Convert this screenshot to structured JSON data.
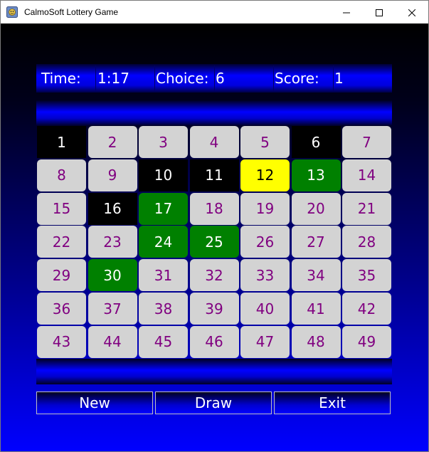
{
  "window": {
    "title": "CalmoSoft Lottery Game"
  },
  "info": {
    "time_label": "Time:",
    "time_value": "1:17",
    "choice_label": "Choice:",
    "choice_value": "6",
    "score_label": "Score:",
    "score_value": "1"
  },
  "grid": {
    "columns": 7,
    "cells": [
      {
        "n": "1",
        "state": "black"
      },
      {
        "n": "2",
        "state": "normal"
      },
      {
        "n": "3",
        "state": "normal"
      },
      {
        "n": "4",
        "state": "normal"
      },
      {
        "n": "5",
        "state": "normal"
      },
      {
        "n": "6",
        "state": "black"
      },
      {
        "n": "7",
        "state": "normal"
      },
      {
        "n": "8",
        "state": "normal"
      },
      {
        "n": "9",
        "state": "normal"
      },
      {
        "n": "10",
        "state": "black"
      },
      {
        "n": "11",
        "state": "black"
      },
      {
        "n": "12",
        "state": "yellow"
      },
      {
        "n": "13",
        "state": "green"
      },
      {
        "n": "14",
        "state": "normal"
      },
      {
        "n": "15",
        "state": "normal"
      },
      {
        "n": "16",
        "state": "black"
      },
      {
        "n": "17",
        "state": "green"
      },
      {
        "n": "18",
        "state": "normal"
      },
      {
        "n": "19",
        "state": "normal"
      },
      {
        "n": "20",
        "state": "normal"
      },
      {
        "n": "21",
        "state": "normal"
      },
      {
        "n": "22",
        "state": "normal"
      },
      {
        "n": "23",
        "state": "normal"
      },
      {
        "n": "24",
        "state": "green"
      },
      {
        "n": "25",
        "state": "green"
      },
      {
        "n": "26",
        "state": "normal"
      },
      {
        "n": "27",
        "state": "normal"
      },
      {
        "n": "28",
        "state": "normal"
      },
      {
        "n": "29",
        "state": "normal"
      },
      {
        "n": "30",
        "state": "green"
      },
      {
        "n": "31",
        "state": "normal"
      },
      {
        "n": "32",
        "state": "normal"
      },
      {
        "n": "33",
        "state": "normal"
      },
      {
        "n": "34",
        "state": "normal"
      },
      {
        "n": "35",
        "state": "normal"
      },
      {
        "n": "36",
        "state": "normal"
      },
      {
        "n": "37",
        "state": "normal"
      },
      {
        "n": "38",
        "state": "normal"
      },
      {
        "n": "39",
        "state": "normal"
      },
      {
        "n": "40",
        "state": "normal"
      },
      {
        "n": "41",
        "state": "normal"
      },
      {
        "n": "42",
        "state": "normal"
      },
      {
        "n": "43",
        "state": "normal"
      },
      {
        "n": "44",
        "state": "normal"
      },
      {
        "n": "45",
        "state": "normal"
      },
      {
        "n": "46",
        "state": "normal"
      },
      {
        "n": "47",
        "state": "normal"
      },
      {
        "n": "48",
        "state": "normal"
      },
      {
        "n": "49",
        "state": "normal"
      }
    ]
  },
  "buttons": {
    "new": "New",
    "draw": "Draw",
    "exit": "Exit"
  },
  "colors": {
    "cell_normal_bg": "#d3d3d3",
    "cell_normal_text": "#800080",
    "cell_marked_bg": "#000000",
    "cell_match_bg": "#008000",
    "cell_current_bg": "#ffff00",
    "background_top": "#000000",
    "background_bottom": "#0000ff"
  },
  "icons": {
    "app": "app-icon",
    "minimize": "minimize-icon",
    "maximize": "maximize-icon",
    "close": "close-icon"
  }
}
